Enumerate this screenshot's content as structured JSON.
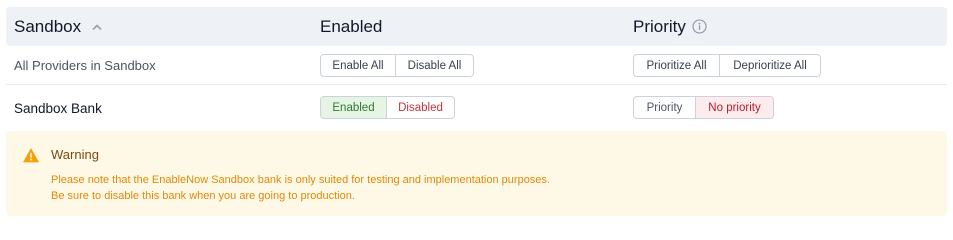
{
  "header": {
    "provider_col": "Sandbox",
    "enabled_col": "Enabled",
    "priority_col": "Priority"
  },
  "all_providers": {
    "label": "All Providers in Sandbox",
    "enable_all": "Enable All",
    "disable_all": "Disable All",
    "prioritize_all": "Prioritize All",
    "deprioritize_all": "Deprioritize All"
  },
  "bank": {
    "label": "Sandbox Bank",
    "enabled": "Enabled",
    "disabled": "Disabled",
    "enabled_state": "Enabled",
    "priority": "Priority",
    "no_priority": "No priority",
    "priority_state": "No priority"
  },
  "warning": {
    "title": "Warning",
    "line1": "Please note that the EnableNow Sandbox bank is only suited for testing and implementation purposes.",
    "line2": "Be sure to disable this bank when you are going to production."
  },
  "icons": {
    "sort": "chevron-up-icon",
    "info": "info-icon",
    "warning": "warning-triangle-icon"
  },
  "colors": {
    "header_bg": "#eef1f6",
    "enabled_active_bg": "#e6f4e3",
    "enabled_active_text": "#2f7a35",
    "disabled_text": "#c0343c",
    "no_priority_bg": "#fcecee",
    "no_priority_text": "#b81b2c",
    "warning_bg": "#fef9e6",
    "warning_accent": "#f2a20c"
  }
}
